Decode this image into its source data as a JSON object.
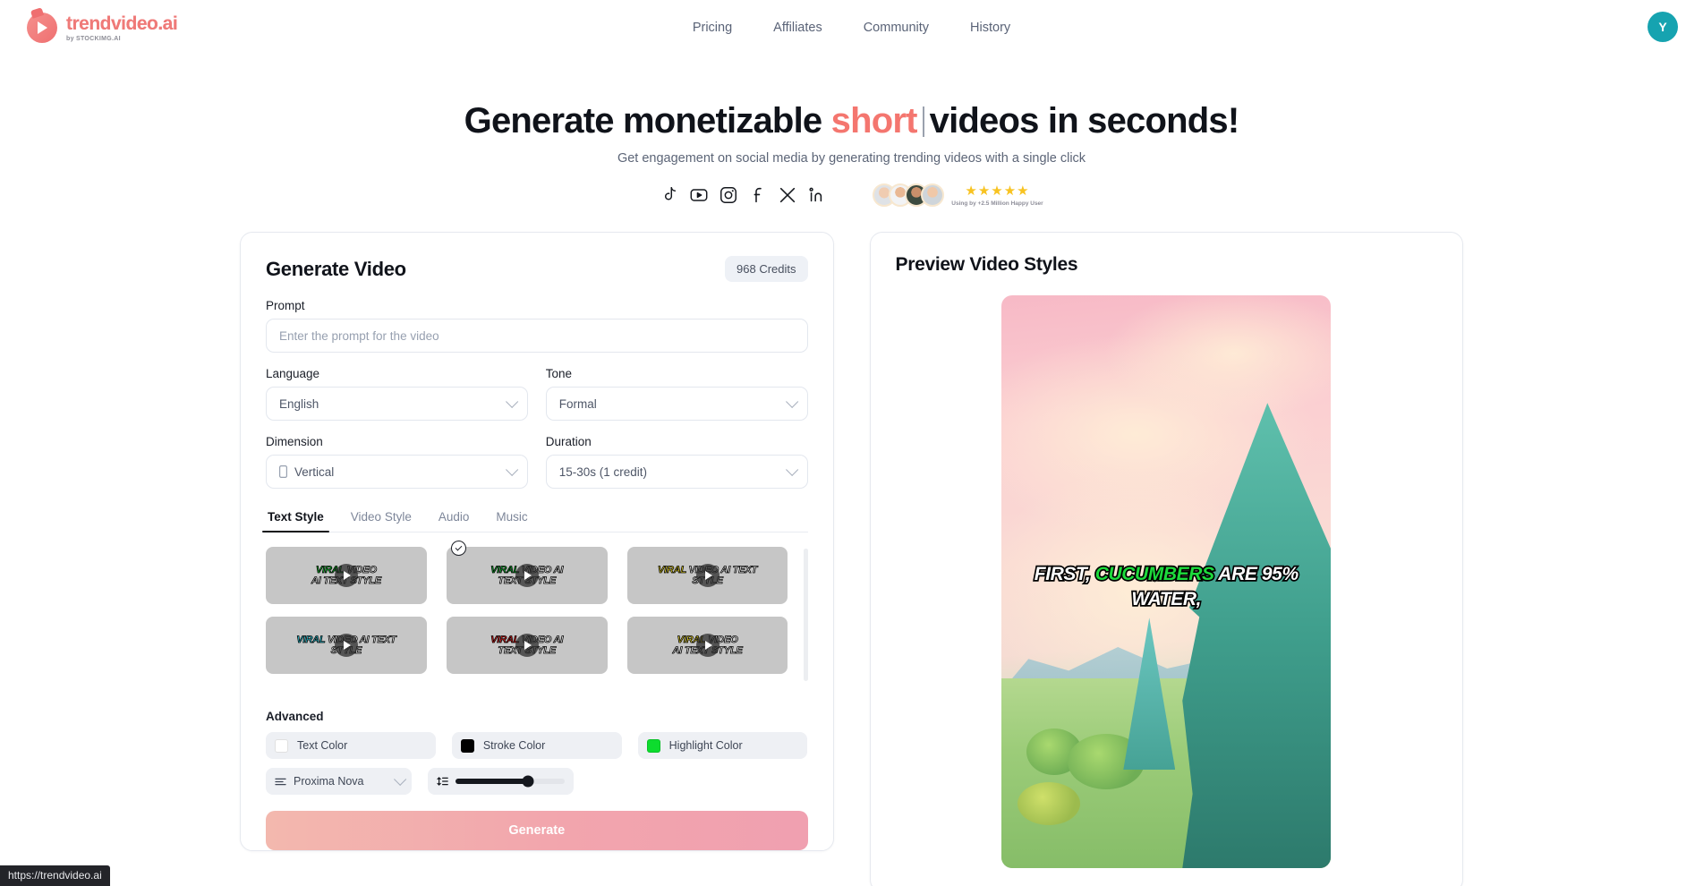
{
  "header": {
    "logo_name": "trendvideo.ai",
    "logo_sub": "by STOCKIMG.AI",
    "nav": [
      {
        "label": "Pricing"
      },
      {
        "label": "Affiliates"
      },
      {
        "label": "Community"
      },
      {
        "label": "History"
      }
    ],
    "avatar_initial": "Y"
  },
  "hero": {
    "title_part1": "Generate monetizable ",
    "title_accent": "short",
    "title_part2": "videos in seconds!",
    "subtitle": "Get engagement on social media by generating trending videos with a single click",
    "social_icons": [
      "tiktok-icon",
      "youtube-icon",
      "instagram-icon",
      "facebook-icon",
      "x-icon",
      "linkedin-icon"
    ],
    "stars": "★★★★★",
    "rating_caption": "Using by +2.5 Million Happy User"
  },
  "generate_panel": {
    "title": "Generate Video",
    "credits": "968 Credits",
    "prompt": {
      "label": "Prompt",
      "placeholder": "Enter the prompt for the video",
      "value": ""
    },
    "language": {
      "label": "Language",
      "value": "English"
    },
    "tone": {
      "label": "Tone",
      "value": "Formal"
    },
    "dimension": {
      "label": "Dimension",
      "value": "Vertical"
    },
    "duration": {
      "label": "Duration",
      "value": "15-30s (1 credit)"
    },
    "tabs": [
      {
        "label": "Text Style",
        "active": true
      },
      {
        "label": "Video Style",
        "active": false
      },
      {
        "label": "Audio",
        "active": false
      },
      {
        "label": "Music",
        "active": false
      }
    ],
    "styles": [
      {
        "line1": "VIRAL VIDEO",
        "line2": "AI TEXT STYLE",
        "accent_word": "VIRAL",
        "accent_color": "#13c531",
        "accent_bg": "",
        "selected": false
      },
      {
        "line1": "VIRAL VIDEO AI",
        "line2": "TEXT STYLE",
        "accent_word": "VIRAL",
        "accent_color": "#0bb62e",
        "accent_bg": "",
        "selected": true
      },
      {
        "line1": "VIRAL VIDEO AI TEXT",
        "line2": "STYLE",
        "accent_word": "VIRAL",
        "accent_color": "#f5e020",
        "accent_bg": "",
        "selected": false
      },
      {
        "line1": "VIRAL VIDEO AI TEXT",
        "line2": "STYLE",
        "accent_word": "VIRAL",
        "accent_color": "#2fd6e8",
        "accent_bg": "",
        "selected": false
      },
      {
        "line1": "VIRAL VIDEO AI",
        "line2": "TEXT STYLE",
        "accent_word": "VIRAL",
        "accent_color": "#ef2020",
        "accent_bg": "",
        "selected": false
      },
      {
        "line1": "VIRAL VIDEO",
        "line2": "AI TEXT STYLE",
        "accent_word": "VIRAL",
        "accent_color": "#f7e32a",
        "accent_bg": "",
        "selected": false
      }
    ],
    "advanced": {
      "title": "Advanced",
      "text_color": {
        "label": "Text Color",
        "color": "#ffffff"
      },
      "stroke_color": {
        "label": "Stroke Color",
        "color": "#000000"
      },
      "highlight_color": {
        "label": "Highlight Color",
        "color": "#0ddc2e"
      },
      "font": {
        "value": "Proxima Nova"
      },
      "size_slider": {
        "value": 66
      }
    },
    "generate_label": "Generate"
  },
  "preview_panel": {
    "title": "Preview Video Styles",
    "caption_part1": "FIRST, ",
    "caption_highlight": "CUCUMBERS",
    "caption_part2": " ARE 95% WATER,"
  },
  "status_bar": {
    "url": "https://trendvideo.ai"
  }
}
